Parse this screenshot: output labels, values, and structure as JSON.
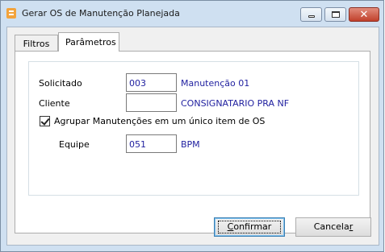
{
  "window": {
    "title": "Gerar OS de Manutenção Planejada",
    "controls": [
      "minimize",
      "maximize",
      "close"
    ]
  },
  "tabs": [
    {
      "label": "Filtros",
      "active": false
    },
    {
      "label": "Parâmetros",
      "active": true
    }
  ],
  "form": {
    "solicitado": {
      "label": "Solicitado",
      "value": "003",
      "description": "Manutenção 01"
    },
    "cliente": {
      "label": "Cliente",
      "value": "",
      "description": "CONSIGNATARIO PRA NF"
    },
    "agrupar": {
      "label": "Agrupar Manutenções em um único item de OS",
      "checked": true
    },
    "equipe": {
      "label": "Equipe",
      "value": "051",
      "description": "BPM"
    }
  },
  "buttons": {
    "confirm_prefix": "C",
    "confirm_rest": "onfirmar",
    "cancel_prefix": "Cancela",
    "cancel_underline": "r"
  },
  "colors": {
    "value_text": "#1f1f9f",
    "window_frame": "#cfe0f1",
    "close_button": "#c1402b"
  }
}
